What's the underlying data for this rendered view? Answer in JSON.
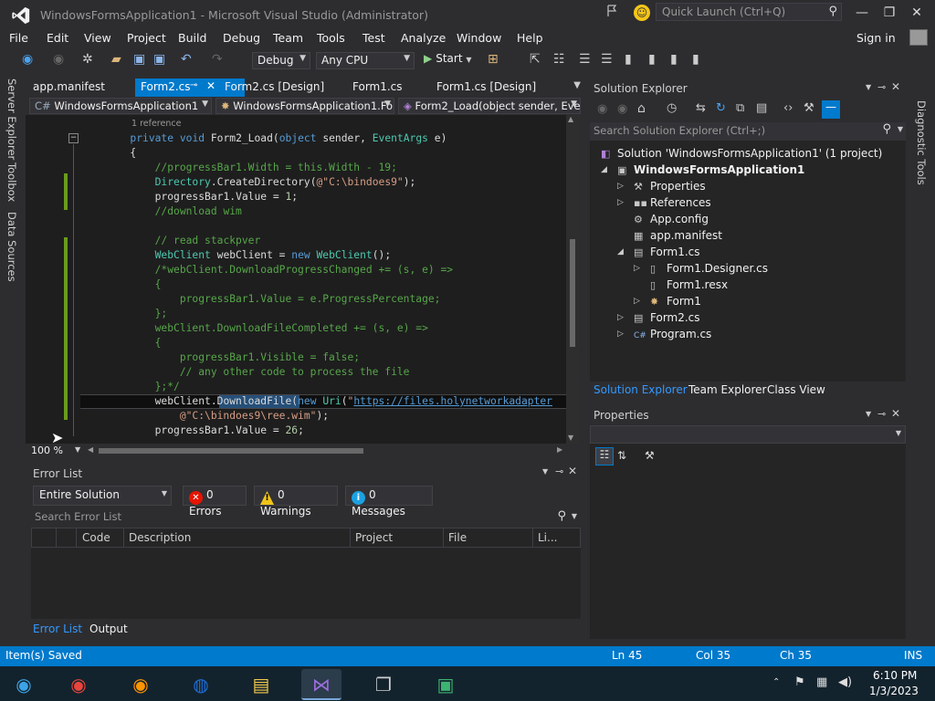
{
  "window": {
    "title": "WindowsFormsApplication1 - Microsoft Visual Studio (Administrator)",
    "quick_launch_placeholder": "Quick Launch (Ctrl+Q)",
    "sign_in": "Sign in"
  },
  "menu": [
    "File",
    "Edit",
    "View",
    "Project",
    "Build",
    "Debug",
    "Team",
    "Tools",
    "Test",
    "Analyze",
    "Window",
    "Help"
  ],
  "toolbar": {
    "configuration": "Debug",
    "platform": "Any CPU",
    "start_label": "Start"
  },
  "left_tool_tabs": [
    "Server Explorer",
    "Toolbox",
    "Data Sources"
  ],
  "document_tabs": [
    "app.manifest",
    "Form2.cs",
    "Form2.cs [Design]",
    "Form1.cs",
    "Form1.cs [Design]"
  ],
  "navbar": {
    "project": "WindowsFormsApplication1",
    "class": "WindowsFormsApplication1.Fo",
    "member": "Form2_Load(object sender, Eve"
  },
  "editor": {
    "references": "1 reference",
    "zoom": "100 %",
    "lines": [
      {
        "t": "        private void Form2_Load(object sender, EventArgs e)"
      },
      {
        "t": "        {"
      },
      {
        "t": "            //progressBar1.Width = this.Width - 19;"
      },
      {
        "t": "            Directory.CreateDirectory(@\"C:\\bindoes9\");"
      },
      {
        "t": "            progressBar1.Value = 1;"
      },
      {
        "t": "            //download wim"
      },
      {
        "t": ""
      },
      {
        "t": "            // read stackpver"
      },
      {
        "t": "            WebClient webClient = new WebClient();"
      },
      {
        "t": "            /*webClient.DownloadProgressChanged += (s, e) =>"
      },
      {
        "t": "            {"
      },
      {
        "t": "                progressBar1.Value = e.ProgressPercentage;"
      },
      {
        "t": "            };"
      },
      {
        "t": "            webClient.DownloadFileCompleted += (s, e) =>"
      },
      {
        "t": "            {"
      },
      {
        "t": "                progressBar1.Visible = false;"
      },
      {
        "t": "                // any other code to process the file"
      },
      {
        "t": "            };*/"
      },
      {
        "t": "            webClient.DownloadFile(new Uri(\"https://files.holynetworkadapter"
      },
      {
        "t": "                @\"C:\\bindoes9\\ree.wim\");"
      },
      {
        "t": "            progressBar1.Value = 26;"
      }
    ]
  },
  "error_list": {
    "title": "Error List",
    "scope": "Entire Solution",
    "errors": "0 Errors",
    "warnings": "0 Warnings",
    "messages": "0 Messages",
    "search_placeholder": "Search Error List",
    "columns": [
      "Code",
      "Description",
      "Project",
      "File",
      "Li..."
    ],
    "tabs": [
      "Error List",
      "Output"
    ]
  },
  "solution_explorer": {
    "title": "Solution Explorer",
    "search_placeholder": "Search Solution Explorer (Ctrl+;)",
    "items": [
      {
        "label": "Solution 'WindowsFormsApplication1' (1 project)",
        "icon": "solution-icon"
      },
      {
        "label": "WindowsFormsApplication1",
        "icon": "csharp-project-icon"
      },
      {
        "label": "Properties",
        "icon": "wrench-icon"
      },
      {
        "label": "References",
        "icon": "references-icon"
      },
      {
        "label": "App.config",
        "icon": "config-icon"
      },
      {
        "label": "app.manifest",
        "icon": "manifest-icon"
      },
      {
        "label": "Form1.cs",
        "icon": "form-icon"
      },
      {
        "label": "Form1.Designer.cs",
        "icon": "cs-file-icon"
      },
      {
        "label": "Form1.resx",
        "icon": "resx-icon"
      },
      {
        "label": "Form1",
        "icon": "class-icon"
      },
      {
        "label": "Form2.cs",
        "icon": "form-icon"
      },
      {
        "label": "Program.cs",
        "icon": "cs-file-icon"
      }
    ],
    "tabs": [
      "Solution Explorer",
      "Team Explorer",
      "Class View"
    ]
  },
  "properties": {
    "title": "Properties"
  },
  "right_tool_tab": "Diagnostic Tools",
  "status": {
    "message": "Item(s) Saved",
    "ln": "Ln 45",
    "col": "Col 35",
    "ch": "Ch 35",
    "mode": "INS"
  },
  "taskbar": {
    "time": "6:10 PM",
    "date": "1/3/2023",
    "apps": [
      "app-icon",
      "chrome-icon",
      "firefox-icon",
      "store-icon",
      "file-explorer-icon",
      "visual-studio-icon",
      "task-view-icon",
      "installer-icon"
    ]
  },
  "colors": {
    "accent": "#007acc",
    "background": "#2d2d30",
    "editor": "#1e1e1e"
  }
}
